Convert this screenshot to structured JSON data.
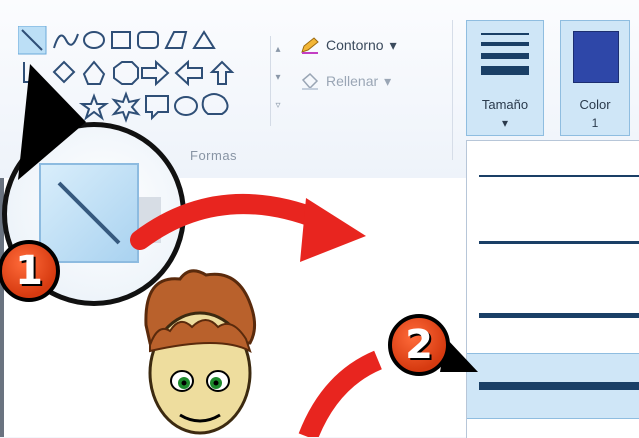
{
  "ribbon": {
    "outline_label": "Contorno",
    "outline_arrow": "▾",
    "fill_label": "Rellenar",
    "fill_arrow": "▾",
    "shapes_group_label": "Formas",
    "size_button": {
      "label": "Tamaño",
      "arrow": "▾"
    },
    "color_button": {
      "label": "Color",
      "sub": "1"
    }
  },
  "size_dropdown": {
    "options": [
      {
        "value": 1,
        "selected": false
      },
      {
        "value": 2,
        "selected": false
      },
      {
        "value": 3,
        "selected": false
      },
      {
        "value": 4,
        "selected": true
      }
    ]
  },
  "callouts": [
    {
      "number": "1"
    },
    {
      "number": "2"
    }
  ],
  "colors": {
    "accent_selected": "#cfe6f7",
    "badge": "#e5481f",
    "arrow": "#e8251f",
    "color1": "#2e47a8"
  }
}
